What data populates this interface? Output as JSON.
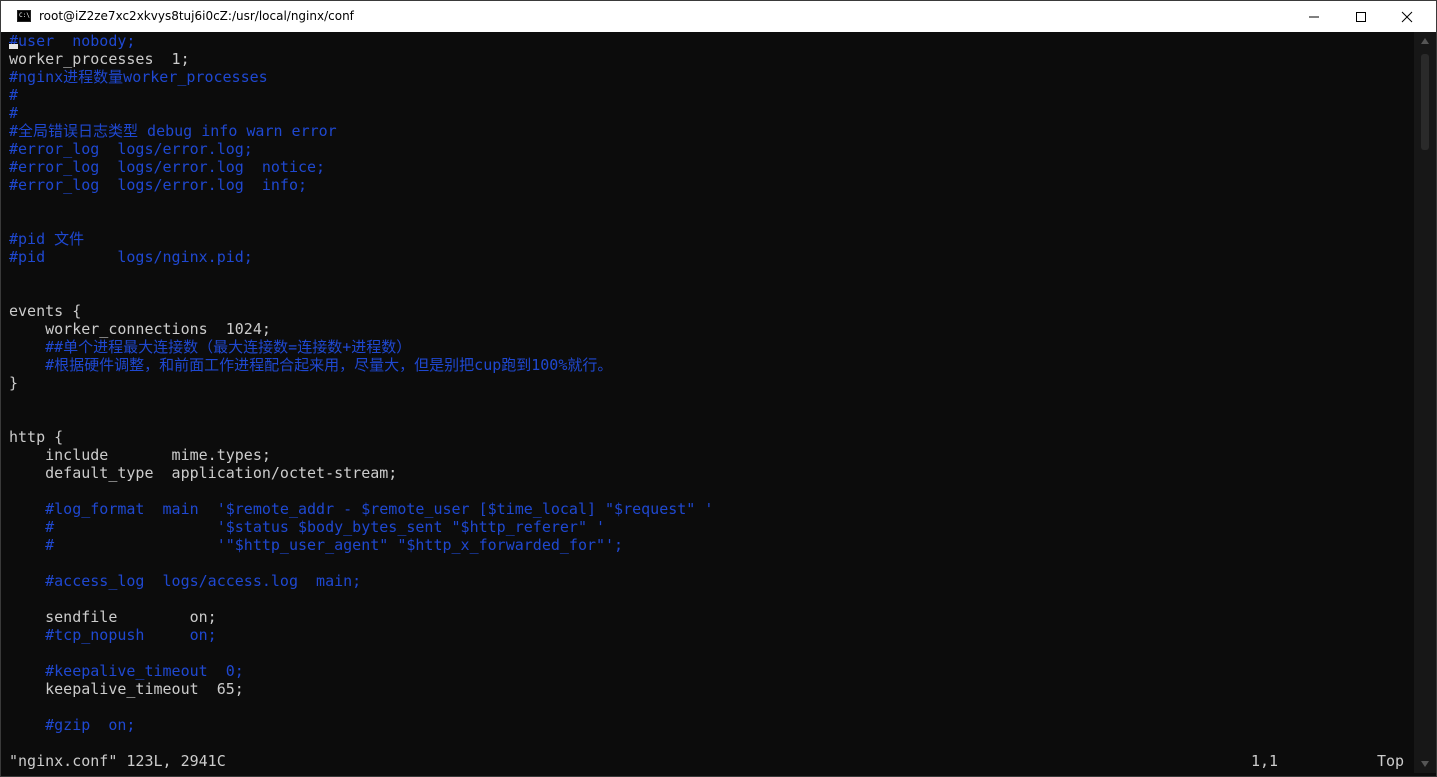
{
  "window": {
    "title": "root@iZ2ze7xc2xkvys8tuj6i0cZ:/usr/local/nginx/conf",
    "icon": "console-icon",
    "controls": [
      "minimize-icon",
      "maximize-icon",
      "close-icon"
    ]
  },
  "colors": {
    "background": "#0c0c0c",
    "text": "#cccccc",
    "comment": "#1f48d1"
  },
  "editor": {
    "lines": [
      {
        "text": "#user  nobody;",
        "type": "comment"
      },
      {
        "text": "worker_processes  1;",
        "type": "code"
      },
      {
        "text": "#nginx进程数量worker_processes",
        "type": "comment"
      },
      {
        "text": "#",
        "type": "comment"
      },
      {
        "text": "#",
        "type": "comment"
      },
      {
        "text": "#全局错误日志类型 debug info warn error",
        "type": "comment"
      },
      {
        "text": "#error_log  logs/error.log;",
        "type": "comment"
      },
      {
        "text": "#error_log  logs/error.log  notice;",
        "type": "comment"
      },
      {
        "text": "#error_log  logs/error.log  info;",
        "type": "comment"
      },
      {
        "text": "",
        "type": "code"
      },
      {
        "text": "",
        "type": "code"
      },
      {
        "text": "#pid 文件",
        "type": "comment"
      },
      {
        "text": "#pid        logs/nginx.pid;",
        "type": "comment"
      },
      {
        "text": "",
        "type": "code"
      },
      {
        "text": "",
        "type": "code"
      },
      {
        "text": "events {",
        "type": "code"
      },
      {
        "text": "    worker_connections  1024;",
        "type": "code"
      },
      {
        "text": "    ##单个进程最大连接数（最大连接数=连接数+进程数）",
        "type": "comment"
      },
      {
        "text": "    #根据硬件调整，和前面工作进程配合起来用，尽量大，但是别把cup跑到100%就行。",
        "type": "comment"
      },
      {
        "text": "}",
        "type": "code"
      },
      {
        "text": "",
        "type": "code"
      },
      {
        "text": "",
        "type": "code"
      },
      {
        "text": "http {",
        "type": "code"
      },
      {
        "text": "    include       mime.types;",
        "type": "code"
      },
      {
        "text": "    default_type  application/octet-stream;",
        "type": "code"
      },
      {
        "text": "",
        "type": "code"
      },
      {
        "text": "    #log_format  main  '$remote_addr - $remote_user [$time_local] \"$request\" '",
        "type": "comment"
      },
      {
        "text": "    #                  '$status $body_bytes_sent \"$http_referer\" '",
        "type": "comment"
      },
      {
        "text": "    #                  '\"$http_user_agent\" \"$http_x_forwarded_for\"';",
        "type": "comment"
      },
      {
        "text": "",
        "type": "code"
      },
      {
        "text": "    #access_log  logs/access.log  main;",
        "type": "comment"
      },
      {
        "text": "",
        "type": "code"
      },
      {
        "text": "    sendfile        on;",
        "type": "code"
      },
      {
        "text": "    #tcp_nopush     on;",
        "type": "comment"
      },
      {
        "text": "",
        "type": "code"
      },
      {
        "text": "    #keepalive_timeout  0;",
        "type": "comment"
      },
      {
        "text": "    keepalive_timeout  65;",
        "type": "code"
      },
      {
        "text": "",
        "type": "code"
      },
      {
        "text": "    #gzip  on;",
        "type": "comment"
      }
    ]
  },
  "status": {
    "file_info": "\"nginx.conf\" 123L, 2941C",
    "cursor_position": "1,1",
    "scroll_position": "Top"
  }
}
